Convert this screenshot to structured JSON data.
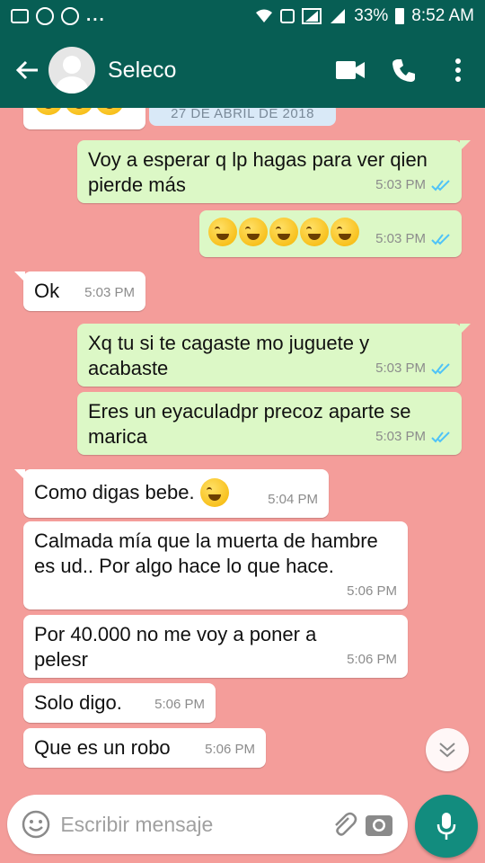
{
  "status_bar": {
    "dots": "...",
    "battery": "33%",
    "time": "8:52 AM"
  },
  "header": {
    "contact_name": "Seleco"
  },
  "date_chip": "27 DE ABRIL DE 2018",
  "messages": [
    {
      "dir": "out",
      "text": "Voy a esperar q lp hagas para ver qien pierde más",
      "time": "5:03 PM"
    },
    {
      "dir": "out",
      "emoji_count": 5,
      "time": "5:03 PM"
    },
    {
      "dir": "in",
      "text": "Ok",
      "time": "5:03 PM"
    },
    {
      "dir": "out",
      "text": "Xq tu si te cagaste mo juguete y acabaste",
      "time": "5:03 PM"
    },
    {
      "dir": "out",
      "text": "Eres un eyaculadpr precoz  aparte se marica",
      "time": "5:03 PM"
    },
    {
      "dir": "in",
      "text": "Como digas bebe.",
      "time": "5:04 PM"
    },
    {
      "dir": "in",
      "text": "Calmada mía que la muerta de hambre es ud.. Por algo hace lo que hace.",
      "time": "5:06 PM"
    },
    {
      "dir": "in",
      "text": "Por 40.000 no me voy a poner a pelesr",
      "time": "5:06 PM"
    },
    {
      "dir": "in",
      "text": "Solo digo.",
      "time": "5:06 PM"
    },
    {
      "dir": "in",
      "text": "Que es un robo",
      "time": "5:06 PM"
    }
  ],
  "input": {
    "placeholder": "Escribir mensaje"
  },
  "colors": {
    "header": "#075e54",
    "chat_bg": "#f49d9a",
    "outgoing": "#dcf8c6",
    "incoming": "#ffffff",
    "ticks": "#4fc3f7",
    "mic": "#128c7e"
  },
  "icons": {
    "back": "back-arrow-icon",
    "video": "video-call-icon",
    "call": "phone-icon",
    "menu": "more-vert-icon",
    "emoji": "emoji-icon",
    "attach": "paperclip-icon",
    "camera": "camera-icon",
    "mic": "mic-icon",
    "scroll": "chevron-double-down-icon"
  }
}
